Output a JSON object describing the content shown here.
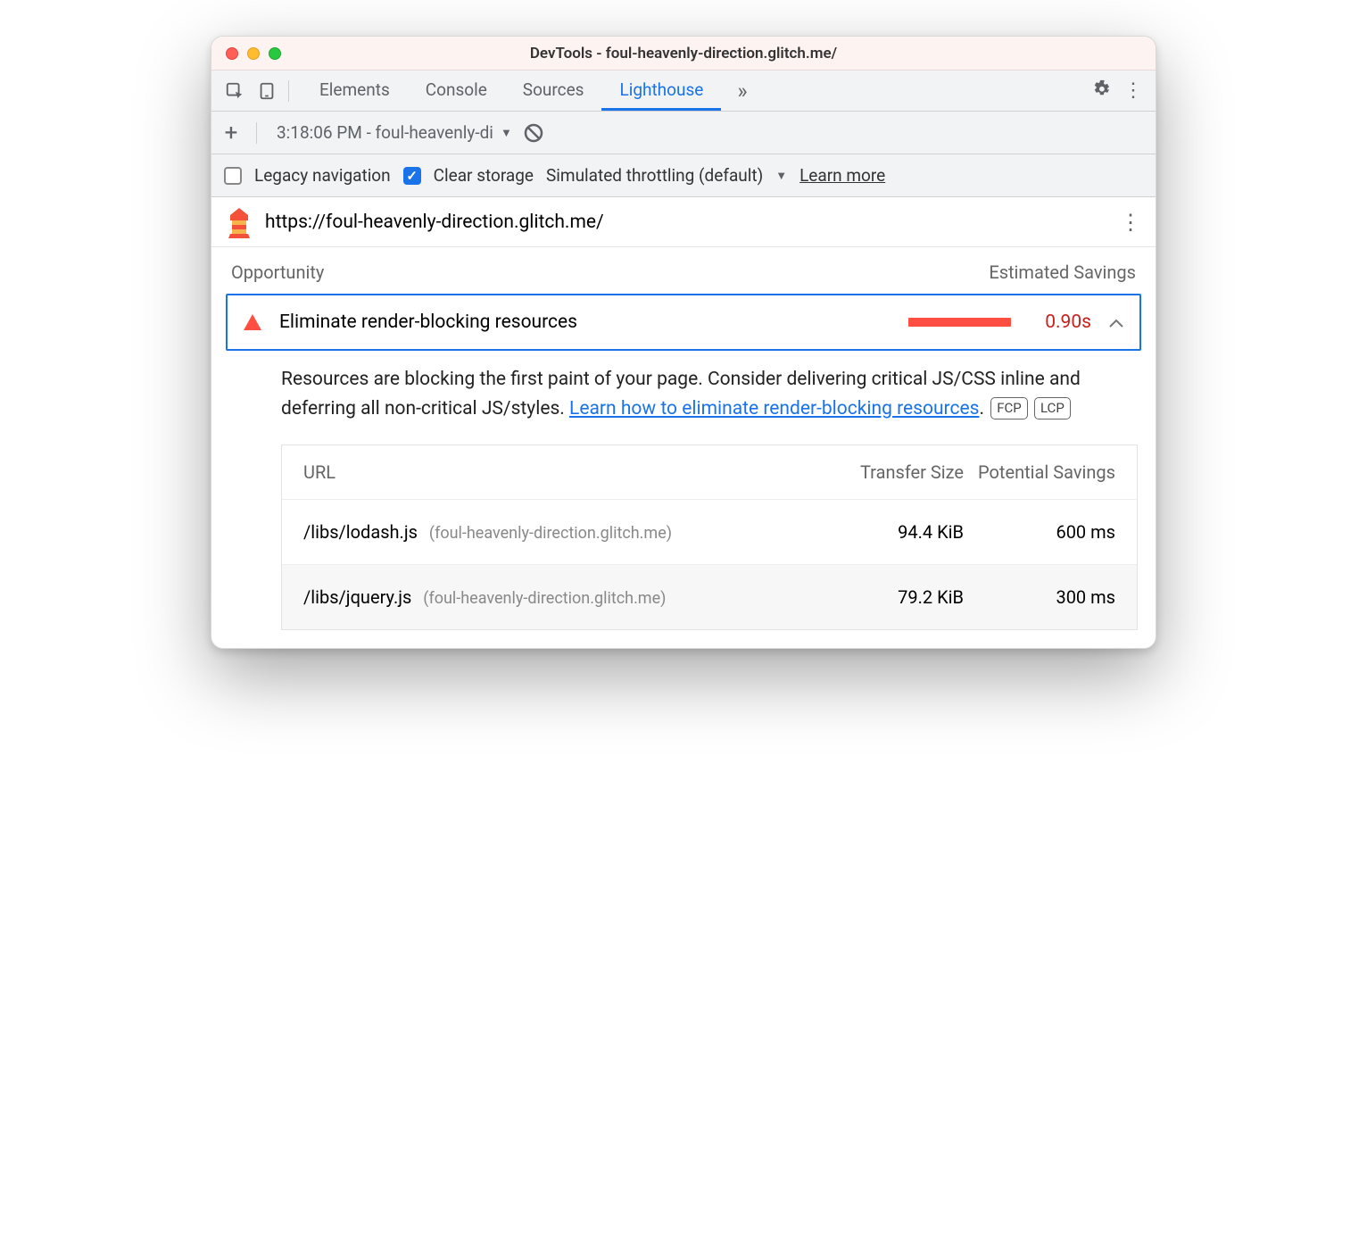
{
  "window": {
    "title": "DevTools - foul-heavenly-direction.glitch.me/"
  },
  "toolbar": {
    "tabs": [
      "Elements",
      "Console",
      "Sources",
      "Lighthouse"
    ],
    "active_tab_index": 3
  },
  "runbar": {
    "run_label": "3:18:06 PM - foul-heavenly-di"
  },
  "options": {
    "legacy_label": "Legacy navigation",
    "legacy_checked": false,
    "clear_label": "Clear storage",
    "clear_checked": true,
    "throttling_label": "Simulated throttling (default)",
    "learn_more": "Learn more"
  },
  "url": "https://foul-heavenly-direction.glitch.me/",
  "headers": {
    "opportunity": "Opportunity",
    "savings": "Estimated Savings"
  },
  "opportunity": {
    "title": "Eliminate render-blocking resources",
    "savings": "0.90s"
  },
  "description": {
    "text_a": "Resources are blocking the first paint of your page. Consider delivering critical JS/CSS inline and deferring all non-critical JS/styles. ",
    "link_text": "Learn how to eliminate render-blocking resources",
    "text_b": ".",
    "pill1": "FCP",
    "pill2": "LCP"
  },
  "table": {
    "headers": {
      "url": "URL",
      "transfer": "Transfer Size",
      "potential": "Potential Savings"
    },
    "rows": [
      {
        "path": "/libs/lodash.js",
        "host": "(foul-heavenly-direction.glitch.me)",
        "size": "94.4 KiB",
        "savings": "600 ms"
      },
      {
        "path": "/libs/jquery.js",
        "host": "(foul-heavenly-direction.glitch.me)",
        "size": "79.2 KiB",
        "savings": "300 ms"
      }
    ]
  }
}
